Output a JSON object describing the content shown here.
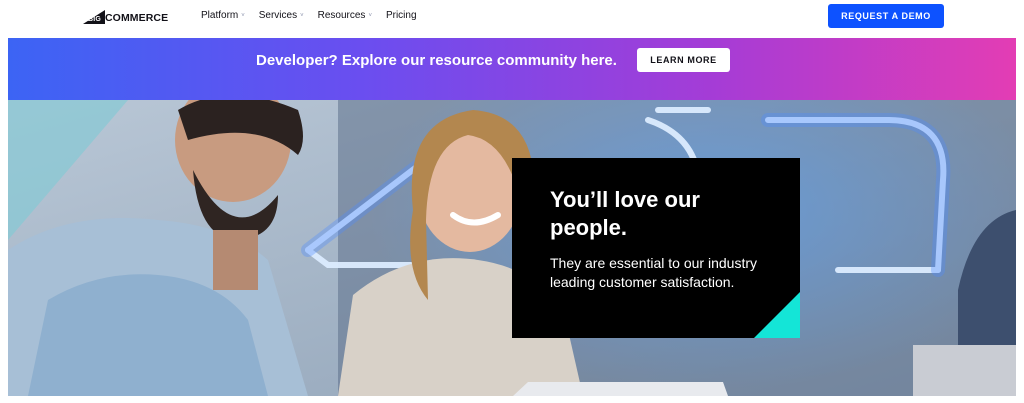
{
  "header": {
    "logo": {
      "mark_text": "BIG",
      "word": "COMMERCE"
    },
    "nav": [
      {
        "label": "Platform",
        "has_dropdown": true
      },
      {
        "label": "Services",
        "has_dropdown": true
      },
      {
        "label": "Resources",
        "has_dropdown": true
      },
      {
        "label": "Pricing",
        "has_dropdown": false
      }
    ],
    "nav_caret": "˅",
    "cta_label": "REQUEST A DEMO"
  },
  "banner": {
    "text": "Developer? Explore our resource community here.",
    "button_label": "LEARN MORE"
  },
  "hero": {
    "card_title": "You’ll love our people.",
    "card_body": "They are essential to our industry leading customer satisfaction."
  },
  "colors": {
    "brand_blue": "#0d52ff",
    "banner_gradient_start": "#3c64f4",
    "banner_gradient_end": "#e33db4",
    "card_accent": "#14e5d7",
    "text_dark": "#121118"
  },
  "icons": {
    "nav_dropdown": "chevron-down-icon",
    "logo": "bigcommerce-logo"
  }
}
